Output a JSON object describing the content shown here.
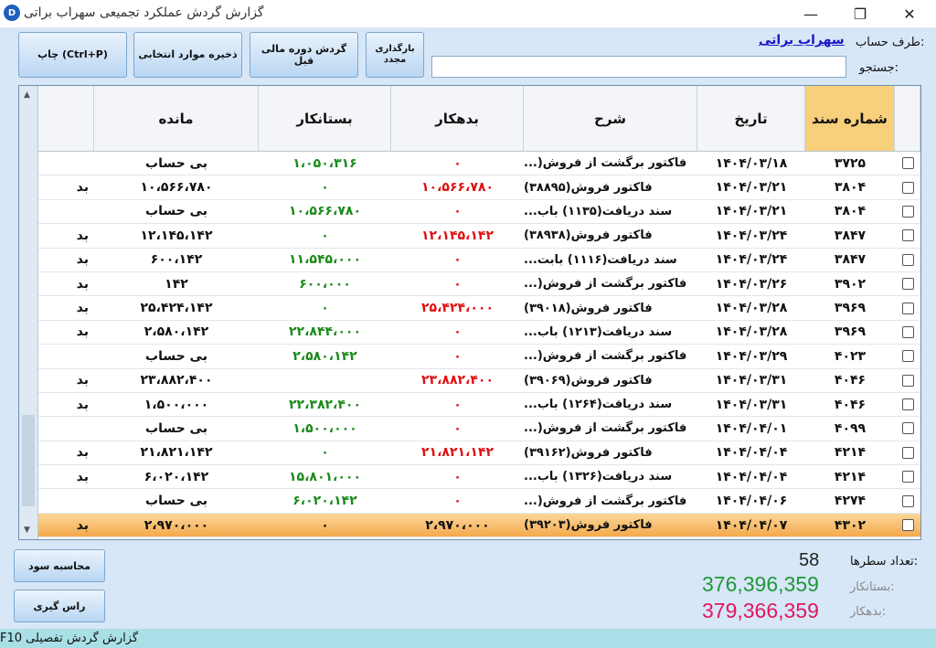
{
  "window": {
    "title": "گزارش گردش عملکرد تجمیعی سهراب براتی",
    "minimize": "—",
    "maximize": "❐",
    "close": "✕"
  },
  "toolbar": {
    "print_label": "چاپ (Ctrl+P)",
    "save_selected_label": "ذخیره موارد انتخابی",
    "prev_period_label": "گردش دوره مالی قبل",
    "reload_label": "بارگذاری مجدد"
  },
  "account": {
    "label": "طرف حساب:",
    "value": "سهراب براتی"
  },
  "search": {
    "label": "جستجو:",
    "value": ""
  },
  "table": {
    "headers": {
      "flag": "",
      "balance": "مانده",
      "credit": "بستانکار",
      "debit": "بدهکار",
      "description": "شرح",
      "date": "تاریخ",
      "doc_no": "شماره سند"
    },
    "rows": [
      {
        "no": "۳۷۲۵",
        "date": "۱۴۰۴/۰۳/۱۸",
        "desc": "فاکتور برگشت از فروش(...",
        "debit": "۰",
        "credit": "۱،۰۵۰،۳۱۶",
        "balance": "بی حساب",
        "flag": ""
      },
      {
        "no": "۳۸۰۴",
        "date": "۱۴۰۴/۰۳/۲۱",
        "desc": "فاکتور فروش(۳۸۸۹۵)",
        "debit": "۱۰،۵۶۶،۷۸۰",
        "credit": "۰",
        "balance": "۱۰،۵۶۶،۷۸۰",
        "flag": "بد"
      },
      {
        "no": "۳۸۰۴",
        "date": "۱۴۰۴/۰۳/۲۱",
        "desc": "سند دریافت(۱۱۳۵) باب...",
        "debit": "۰",
        "credit": "۱۰،۵۶۶،۷۸۰",
        "balance": "بی حساب",
        "flag": ""
      },
      {
        "no": "۳۸۴۷",
        "date": "۱۴۰۴/۰۳/۲۴",
        "desc": "فاکتور فروش(۳۸۹۳۸)",
        "debit": "۱۲،۱۴۵،۱۴۲",
        "credit": "۰",
        "balance": "۱۲،۱۴۵،۱۴۲",
        "flag": "بد"
      },
      {
        "no": "۳۸۴۷",
        "date": "۱۴۰۴/۰۳/۲۴",
        "desc": "سند دریافت(۱۱۱۶) بابت...",
        "debit": "۰",
        "credit": "۱۱،۵۴۵،۰۰۰",
        "balance": "۶۰۰،۱۴۲",
        "flag": "بد"
      },
      {
        "no": "۳۹۰۲",
        "date": "۱۴۰۴/۰۳/۲۶",
        "desc": "فاکتور برگشت از فروش(...",
        "debit": "۰",
        "credit": "۶۰۰،۰۰۰",
        "balance": "۱۴۲",
        "flag": "بد"
      },
      {
        "no": "۳۹۶۹",
        "date": "۱۴۰۴/۰۳/۲۸",
        "desc": "فاکتور فروش(۳۹۰۱۸)",
        "debit": "۲۵،۴۲۴،۰۰۰",
        "credit": "۰",
        "balance": "۲۵،۴۲۴،۱۴۲",
        "flag": "بد"
      },
      {
        "no": "۳۹۶۹",
        "date": "۱۴۰۴/۰۳/۲۸",
        "desc": "سند دریافت(۱۲۱۳) باب...",
        "debit": "۰",
        "credit": "۲۲،۸۴۴،۰۰۰",
        "balance": "۲،۵۸۰،۱۴۲",
        "flag": "بد"
      },
      {
        "no": "۴۰۲۳",
        "date": "۱۴۰۴/۰۳/۲۹",
        "desc": "فاکتور برگشت از فروش(...",
        "debit": "۰",
        "credit": "۲،۵۸۰،۱۴۲",
        "balance": "بی حساب",
        "flag": ""
      },
      {
        "no": "۴۰۴۶",
        "date": "۱۴۰۴/۰۳/۳۱",
        "desc": "فاکتور فروش(۳۹۰۶۹)",
        "debit": "۲۳،۸۸۲،۴۰۰",
        "credit": "",
        "balance": "۲۳،۸۸۲،۴۰۰",
        "flag": "بد"
      },
      {
        "no": "۴۰۴۶",
        "date": "۱۴۰۴/۰۳/۳۱",
        "desc": "سند دریافت(۱۲۶۴) باب...",
        "debit": "۰",
        "credit": "۲۲،۳۸۲،۴۰۰",
        "balance": "۱،۵۰۰،۰۰۰",
        "flag": "بد"
      },
      {
        "no": "۴۰۹۹",
        "date": "۱۴۰۴/۰۴/۰۱",
        "desc": "فاکتور برگشت از فروش(...",
        "debit": "۰",
        "credit": "۱،۵۰۰،۰۰۰",
        "balance": "بی حساب",
        "flag": ""
      },
      {
        "no": "۴۲۱۴",
        "date": "۱۴۰۴/۰۴/۰۴",
        "desc": "فاکتور فروش(۳۹۱۶۲)",
        "debit": "۲۱،۸۲۱،۱۴۲",
        "credit": "۰",
        "balance": "۲۱،۸۲۱،۱۴۲",
        "flag": "بد"
      },
      {
        "no": "۴۲۱۴",
        "date": "۱۴۰۴/۰۴/۰۴",
        "desc": "سند دریافت(۱۳۲۶) باب...",
        "debit": "۰",
        "credit": "۱۵،۸۰۱،۰۰۰",
        "balance": "۶،۰۲۰،۱۴۲",
        "flag": "بد"
      },
      {
        "no": "۴۲۷۴",
        "date": "۱۴۰۴/۰۴/۰۶",
        "desc": "فاکتور برگشت از فروش(...",
        "debit": "۰",
        "credit": "۶،۰۲۰،۱۴۲",
        "balance": "بی حساب",
        "flag": ""
      },
      {
        "no": "۴۳۰۲",
        "date": "۱۴۰۴/۰۴/۰۷",
        "desc": "فاکتور فروش(۳۹۲۰۳)",
        "debit": "۲،۹۷۰،۰۰۰",
        "credit": "۰",
        "balance": "۲،۹۷۰،۰۰۰",
        "flag": "بد",
        "selected": true
      }
    ]
  },
  "buttons": {
    "profit_label": "محاسبه سود",
    "avg_label": "راس گیری"
  },
  "summary": {
    "rows_label": "تعداد سطرها:",
    "rows_value": "58",
    "credit_label": "بستانکار:",
    "credit_value": "376,396,359",
    "debit_label": "بدهکار:",
    "debit_value": "379,366,359"
  },
  "statusbar": {
    "text": "گزارش گردش تفصیلی F10"
  }
}
